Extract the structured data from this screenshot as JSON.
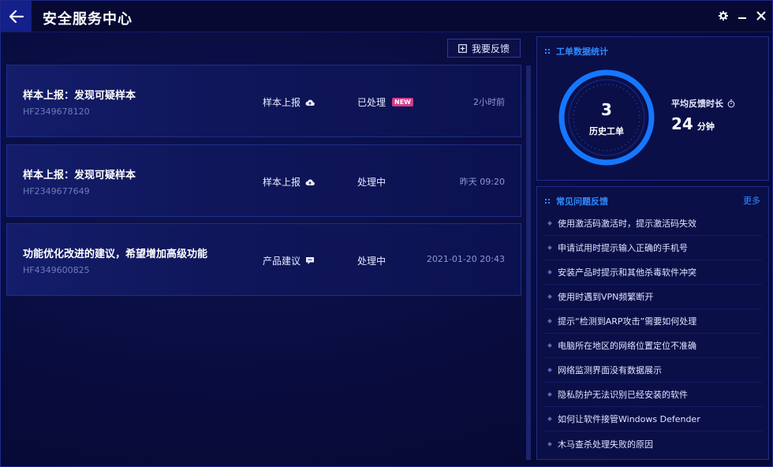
{
  "header": {
    "title": "安全服务中心"
  },
  "toolbar": {
    "feedback_label": "我要反馈"
  },
  "tickets": [
    {
      "title": "样本上报：发现可疑样本",
      "id": "HF2349678120",
      "type": "样本上报",
      "type_icon": "cloud-upload-icon",
      "status": "已处理",
      "badge": "NEW",
      "time": "2小时前"
    },
    {
      "title": "样本上报：发现可疑样本",
      "id": "HF2349677649",
      "type": "样本上报",
      "type_icon": "cloud-upload-icon",
      "status": "处理中",
      "badge": "",
      "time": "昨天 09:20"
    },
    {
      "title": "功能优化改进的建议，希望增加高级功能",
      "id": "HF4349600825",
      "type": "产品建议",
      "type_icon": "comment-icon",
      "status": "处理中",
      "badge": "",
      "time": "2021-01-20 20:43"
    }
  ],
  "stats": {
    "title": "工单数据统计",
    "history_count": "3",
    "history_label": "历史工单",
    "avg_label": "平均反馈时长",
    "avg_value": "24",
    "avg_unit": "分钟"
  },
  "faq": {
    "title": "常见问题反馈",
    "more_label": "更多",
    "items": [
      "使用激活码激活时，提示激活码失效",
      "申请试用时提示输入正确的手机号",
      "安装产品时提示和其他杀毒软件冲突",
      "使用时遇到VPN频繁断开",
      "提示“检测到ARP攻击”需要如何处理",
      "电脑所在地区的网络位置定位不准确",
      "网络监测界面没有数据展示",
      "隐私防护无法识别已经安装的软件",
      "如何让软件接管Windows Defender",
      "木马查杀处理失败的原因"
    ]
  },
  "colors": {
    "accent": "#2f8cff",
    "background": "#080a3a",
    "badge_new": "#d23a8a",
    "back_button": "#14218a"
  }
}
